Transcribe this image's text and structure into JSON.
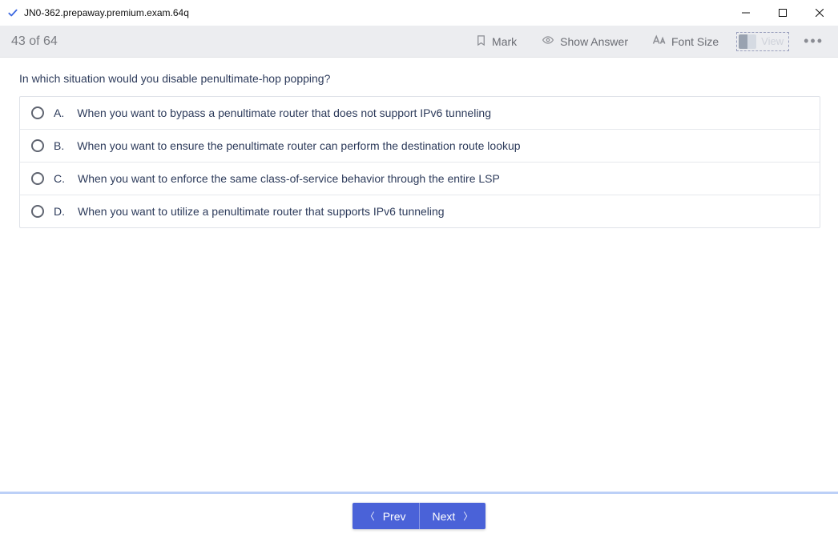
{
  "window": {
    "title": "JN0-362.prepaway.premium.exam.64q"
  },
  "toolbar": {
    "counter": "43 of 64",
    "mark": "Mark",
    "show_answer": "Show Answer",
    "font_size": "Font Size",
    "view": "View"
  },
  "question": {
    "text": "In which situation would you disable penultimate-hop popping?",
    "answers": [
      {
        "letter": "A.",
        "text": "When you want to bypass a penultimate router that does not support IPv6 tunneling"
      },
      {
        "letter": "B.",
        "text": "When you want to ensure the penultimate router can perform the destination route lookup"
      },
      {
        "letter": "C.",
        "text": "When you want to enforce the same class-of-service behavior through the entire LSP"
      },
      {
        "letter": "D.",
        "text": "When you want to utilize a penultimate router that supports IPv6 tunneling"
      }
    ]
  },
  "footer": {
    "prev": "Prev",
    "next": "Next"
  }
}
